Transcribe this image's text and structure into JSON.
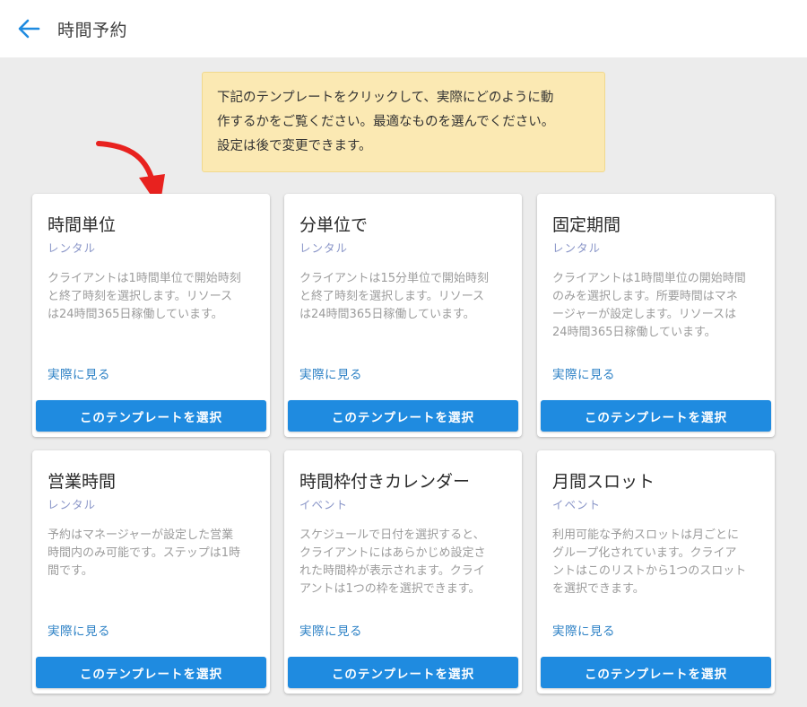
{
  "header": {
    "title": "時間予約",
    "back_icon": "arrow-left-icon",
    "accent_color": "#1f8be0"
  },
  "notice": {
    "lines": [
      "下記のテンプレートをクリックして、実際にどのように動",
      "作するかをご覧ください。最適なものを選んでください。",
      "設定は後で変更できます。"
    ],
    "background": "#fbe9b3"
  },
  "annotation": {
    "icon": "red-curved-arrow-icon",
    "color": "#e8221f"
  },
  "cards": [
    {
      "title": "時間単位",
      "subtitle": "レンタル",
      "description": [
        "クライアントは1時間単位で開始時刻",
        "と終了時刻を選択します。リソース",
        "は24時間365日稼働しています。"
      ],
      "link": "実際に見る",
      "button": "このテンプレートを選択"
    },
    {
      "title": "分単位で",
      "subtitle": "レンタル",
      "description": [
        "クライアントは15分単位で開始時刻",
        "と終了時刻を選択します。リソース",
        "は24時間365日稼働しています。"
      ],
      "link": "実際に見る",
      "button": "このテンプレートを選択"
    },
    {
      "title": "固定期間",
      "subtitle": "レンタル",
      "description": [
        "クライアントは1時間単位の開始時間",
        "のみを選択します。所要時間はマネ",
        "ージャーが設定します。リソースは",
        "24時間365日稼働しています。"
      ],
      "link": "実際に見る",
      "button": "このテンプレートを選択"
    },
    {
      "title": "営業時間",
      "subtitle": "レンタル",
      "description": [
        "予約はマネージャーが設定した営業",
        "時間内のみ可能です。ステップは1時",
        "間です。"
      ],
      "link": "実際に見る",
      "button": "このテンプレートを選択"
    },
    {
      "title": "時間枠付きカレンダー",
      "subtitle": "イベント",
      "description": [
        "スケジュールで日付を選択すると、",
        "クライアントにはあらかじめ設定さ",
        "れた時間枠が表示されます。クライ",
        "アントは1つの枠を選択できます。"
      ],
      "link": "実際に見る",
      "button": "このテンプレートを選択"
    },
    {
      "title": "月間スロット",
      "subtitle": "イベント",
      "description": [
        "利用可能な予約スロットは月ごとに",
        "グループ化されています。クライア",
        "ントはこのリストから1つのスロット",
        "を選択できます。"
      ],
      "link": "実際に見る",
      "button": "このテンプレートを選択"
    }
  ]
}
